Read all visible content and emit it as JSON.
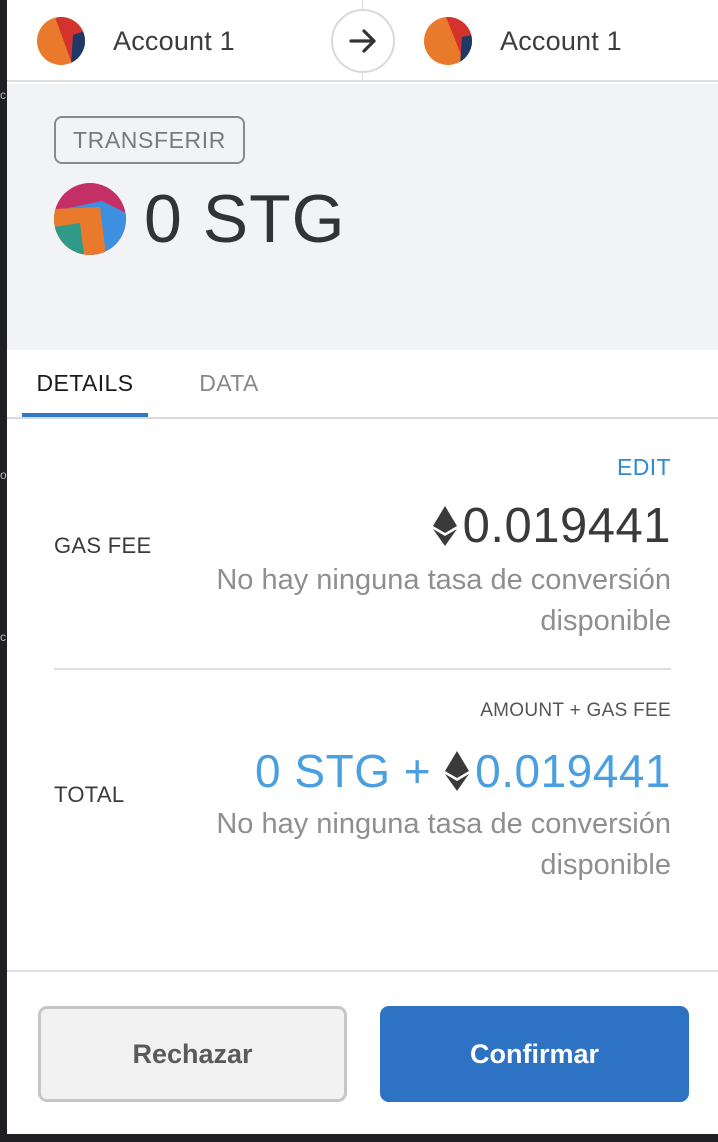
{
  "header": {
    "from_account": {
      "name": "Account 1",
      "avatar": "jazzicon-orange-red-navy"
    },
    "to_account": {
      "name": "Account 1",
      "avatar": "jazzicon-orange-red-navy"
    },
    "arrow_icon": "arrow-right-icon"
  },
  "summary": {
    "action": "TRANSFERIR",
    "token_amount": "0 STG",
    "token_avatar": "jazzicon-magenta-blue-teal-orange"
  },
  "tabs": [
    {
      "label": "DETAILS",
      "active": true
    },
    {
      "label": "DATA",
      "active": false
    }
  ],
  "details": {
    "edit_label": "EDIT",
    "gas_fee_label": "GAS FEE",
    "gas_fee_value": "0.019441",
    "gas_fee_currency_icon": "ethereum-icon",
    "gas_fee_note": "No hay ninguna tasa de conversión disponible",
    "total_subtitle": "AMOUNT + GAS FEE",
    "total_label": "TOTAL",
    "total_token": "0 STG +",
    "total_value": "0.019441",
    "total_currency_icon": "ethereum-icon",
    "total_note": "No hay ninguna tasa de conversión disponible"
  },
  "footer": {
    "reject_label": "Rechazar",
    "confirm_label": "Confirmar"
  },
  "colors": {
    "accent_blue": "#2e73c3",
    "link_blue": "#2f8ad8",
    "total_blue": "#4a9fe0",
    "summary_bg": "#f2f3f4"
  }
}
